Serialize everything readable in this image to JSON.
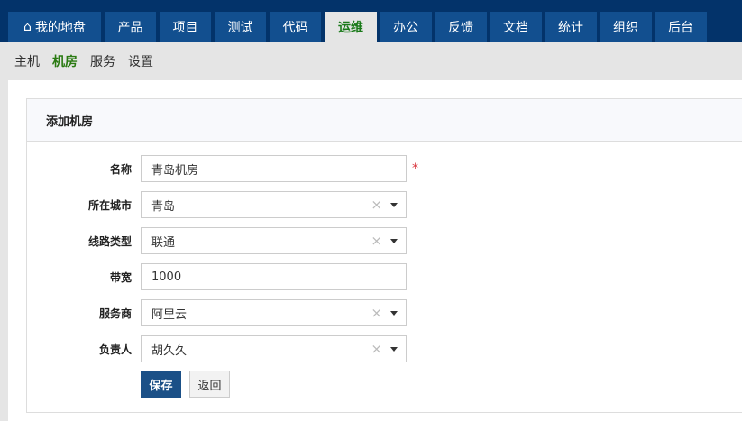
{
  "nav": {
    "tabs": [
      "我的地盘",
      "产品",
      "项目",
      "测试",
      "代码",
      "运维",
      "办公",
      "反馈",
      "文档",
      "统计",
      "组织",
      "后台"
    ],
    "active": "运维"
  },
  "subnav": {
    "items": [
      "主机",
      "机房",
      "服务",
      "设置"
    ],
    "active": "机房"
  },
  "panel": {
    "title": "添加机房"
  },
  "form": {
    "name": {
      "label": "名称",
      "value": "青岛机房",
      "required": "*"
    },
    "city": {
      "label": "所在城市",
      "value": "青岛"
    },
    "line": {
      "label": "线路类型",
      "value": "联通"
    },
    "bandwidth": {
      "label": "带宽",
      "value": "1000"
    },
    "provider": {
      "label": "服务商",
      "value": "阿里云"
    },
    "owner": {
      "label": "负责人",
      "value": "胡久久"
    },
    "save": "保存",
    "back": "返回"
  },
  "icons": {
    "clear": "×"
  }
}
